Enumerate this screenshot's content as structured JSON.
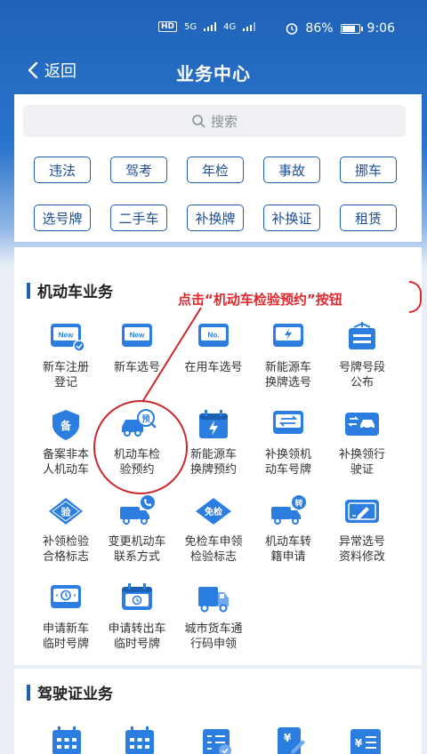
{
  "status_bar": {
    "left_badges": [
      "HD",
      "5G",
      "4G"
    ],
    "battery": "86%",
    "battery_level": 0.86,
    "time": "9:06"
  },
  "nav": {
    "back_label": "返回",
    "title": "业务中心"
  },
  "search": {
    "placeholder": "搜索"
  },
  "quick_tags": [
    "违法",
    "驾考",
    "年检",
    "事故",
    "挪车",
    "选号牌",
    "二手车",
    "补换牌",
    "补换证",
    "租赁"
  ],
  "motor_section": {
    "title": "机动车业务",
    "annotation": "点击“机动车检验预约”按钮",
    "items": [
      {
        "label": "新车注册\n登记",
        "icon": "new-car-register-icon"
      },
      {
        "label": "新车选号",
        "icon": "new-plate-icon"
      },
      {
        "label": "在用车选号",
        "icon": "plate-number-icon"
      },
      {
        "label": "新能源车\n换牌选号",
        "icon": "ev-plate-icon"
      },
      {
        "label": "号牌号段\n公布",
        "icon": "plate-sign-icon"
      },
      {
        "label": "备案非本\n人机动车",
        "icon": "record-shield-icon"
      },
      {
        "label": "机动车检\n验预约",
        "icon": "inspection-booking-icon"
      },
      {
        "label": "新能源车\n换牌预约",
        "icon": "ev-calendar-icon"
      },
      {
        "label": "补换领机\n动车号牌",
        "icon": "plate-swap-icon"
      },
      {
        "label": "补换领行\n驶证",
        "icon": "license-swap-icon"
      },
      {
        "label": "补领检验\n合格标志",
        "icon": "inspection-badge-icon"
      },
      {
        "label": "变更机动车\n联系方式",
        "icon": "truck-phone-icon"
      },
      {
        "label": "免检车申领\n检验标志",
        "icon": "exempt-badge-icon"
      },
      {
        "label": "机动车转\n籍申请",
        "icon": "truck-transfer-icon"
      },
      {
        "label": "异常选号\n资料修改",
        "icon": "card-edit-icon"
      },
      {
        "label": "申请新车\n临时号牌",
        "icon": "temp-plate-icon"
      },
      {
        "label": "申请转出车\n临时号牌",
        "icon": "temp-plate-out-icon"
      },
      {
        "label": "城市货车通\n行码申领",
        "icon": "cargo-truck-icon"
      }
    ],
    "badge_texts": {
      "new": "New",
      "no": "No.",
      "bei": "备",
      "yu": "预",
      "yan": "验",
      "mianjian": "免检",
      "zhuan": "转"
    }
  },
  "driver_section": {
    "title": "驾驶证业务",
    "icons": [
      "calendar-icon",
      "calendar-icon",
      "checklist-icon",
      "yuan-pen-icon",
      "yuan-list-icon"
    ]
  },
  "colors": {
    "header_blue": "#1f63b8",
    "accent_blue": "#1e5fb3",
    "icon_blue": "#2b7de0",
    "annotation_red": "#e3262b"
  }
}
